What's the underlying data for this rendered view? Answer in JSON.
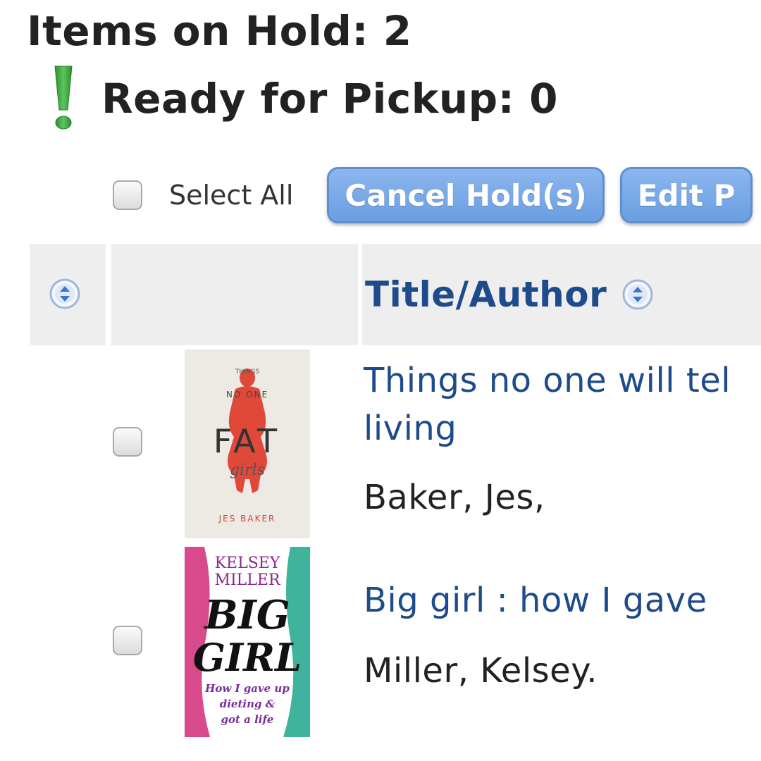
{
  "summary": {
    "items_on_hold": "Items on Hold: 2",
    "ready_for_pickup": "Ready for Pickup: 0"
  },
  "toolbar": {
    "select_all_label": "Select All",
    "cancel_button": "Cancel Hold(s)",
    "edit_button": "Edit P"
  },
  "table": {
    "title_author_header": "Title/Author"
  },
  "items": [
    {
      "title_line1": "Things no one will tel",
      "title_line2": "living",
      "author": "Baker, Jes,",
      "cover": {
        "top_small": "THINGS",
        "no_one": "NO ONE",
        "fat": "FAT",
        "girls": "girls",
        "author": "JES BAKER"
      }
    },
    {
      "title": "Big girl : how I gave",
      "author": "Miller, Kelsey.",
      "cover": {
        "author_line1": "KELSEY",
        "author_line2": "MILLER",
        "big": "BIG",
        "girl": "GIRL",
        "subtitle_line1": "How I gave up",
        "subtitle_line2": "dieting &",
        "subtitle_line3": "got a life"
      }
    }
  ],
  "colors": {
    "link_blue": "#1e4b8c",
    "button_blue": "#6a9ee2",
    "exclamation_green": "#3aa53a",
    "header_gray": "#eeeeee"
  },
  "icons": {
    "ready": "exclamation-icon",
    "sort": "sort-icon"
  }
}
